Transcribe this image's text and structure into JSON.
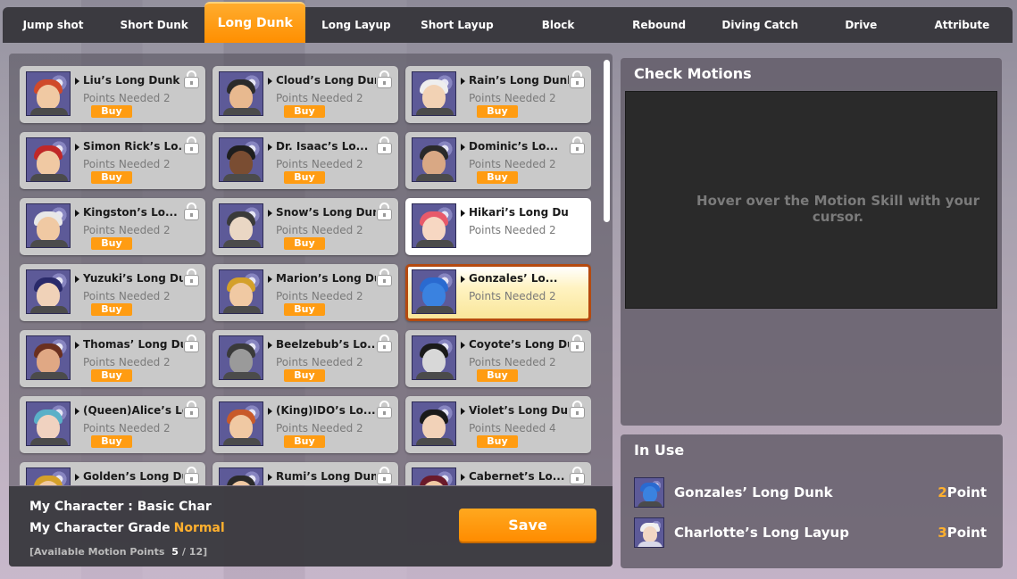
{
  "tabs": [
    {
      "label": "Jump shot",
      "active": false
    },
    {
      "label": "Short Dunk",
      "active": false
    },
    {
      "label": "Long Dunk",
      "active": true
    },
    {
      "label": "Long Layup",
      "active": false
    },
    {
      "label": "Short Layup",
      "active": false
    },
    {
      "label": "Block",
      "active": false
    },
    {
      "label": "Rebound",
      "active": false
    },
    {
      "label": "Diving Catch",
      "active": false
    },
    {
      "label": "Drive",
      "active": false
    },
    {
      "label": "Attribute",
      "active": false
    }
  ],
  "skills": [
    {
      "name": "Liu’s Long Dunk",
      "points": "Points Needed 2",
      "buy": "Buy",
      "state": "locked",
      "hair": "#d04a2a",
      "skin": "#f0c9a3"
    },
    {
      "name": "Cloud’s Long Dunk",
      "points": "Points Needed 2",
      "buy": "Buy",
      "state": "locked",
      "hair": "#2b2b2b",
      "skin": "#e8b98f"
    },
    {
      "name": "Rain’s Long Dunk",
      "points": "Points Needed 2",
      "buy": "Buy",
      "state": "locked",
      "hair": "#eeeeee",
      "skin": "#f2d2b4"
    },
    {
      "name": "Simon Rick’s Lo...",
      "points": "Points Needed 2",
      "buy": "Buy",
      "state": "locked",
      "hair": "#c02828",
      "skin": "#f0c9a3"
    },
    {
      "name": "Dr. Isaac’s Lo...",
      "points": "Points Needed 2",
      "buy": "Buy",
      "state": "locked",
      "hair": "#1e1e1e",
      "skin": "#7a4d32"
    },
    {
      "name": "Dominic’s Lo...",
      "points": "Points Needed 2",
      "buy": "Buy",
      "state": "locked",
      "hair": "#2a2a2a",
      "skin": "#d9a884"
    },
    {
      "name": "Kingston’s Lo...",
      "points": "Points Needed 2",
      "buy": "Buy",
      "state": "locked",
      "hair": "#e8e8e8",
      "skin": "#f0c9a3"
    },
    {
      "name": "Snow’s Long Dunk",
      "points": "Points Needed 2",
      "buy": "Buy",
      "state": "locked",
      "hair": "#3a3a3a",
      "skin": "#ead7c4"
    },
    {
      "name": "Hikari’s Long Dunk",
      "points": "Points Needed 2",
      "buy": "",
      "state": "owned",
      "hair": "#e85a6a",
      "skin": "#f7d7c2"
    },
    {
      "name": "Yuzuki’s Long Dunk",
      "points": "Points Needed 2",
      "buy": "Buy",
      "state": "locked",
      "hair": "#2a2a6a",
      "skin": "#f0d2b8"
    },
    {
      "name": "Marion’s Long Dunk",
      "points": "Points Needed 2",
      "buy": "Buy",
      "state": "locked",
      "hair": "#d4a02a",
      "skin": "#f0c9a3"
    },
    {
      "name": "Gonzales’ Lo...",
      "points": "Points Needed 2",
      "buy": "",
      "state": "selected",
      "hair": "#2a6ad0",
      "skin": "#3a82e0"
    },
    {
      "name": "Thomas’ Long Dunk",
      "points": "Points Needed 2",
      "buy": "Buy",
      "state": "locked",
      "hair": "#6a3020",
      "skin": "#e0a884"
    },
    {
      "name": "Beelzebub’s Lo...",
      "points": "Points Needed 2",
      "buy": "Buy",
      "state": "locked",
      "hair": "#3a3a3a",
      "skin": "#9a9a9a"
    },
    {
      "name": "Coyote’s Long Dunk",
      "points": "Points Needed 2",
      "buy": "Buy",
      "state": "locked",
      "hair": "#1a1a1a",
      "skin": "#d8d8d8"
    },
    {
      "name": "(Queen)Alice’s Lo...",
      "points": "Points Needed 2",
      "buy": "Buy",
      "state": "locked",
      "hair": "#5ab0c8",
      "skin": "#f0d2c0"
    },
    {
      "name": "(King)IDO’s Lo...",
      "points": "Points Needed 2",
      "buy": "Buy",
      "state": "locked",
      "hair": "#c85a2a",
      "skin": "#f0c9a3"
    },
    {
      "name": "Violet’s Long Dunk",
      "points": "Points Needed 4",
      "buy": "Buy",
      "state": "locked",
      "hair": "#1a1a1a",
      "skin": "#f2d2b8"
    },
    {
      "name": "Golden’s Long Dunk",
      "points": "",
      "buy": "",
      "state": "locked",
      "hair": "#d4a02a",
      "skin": "#f0c9a3"
    },
    {
      "name": "Rumi’s Long Dunk",
      "points": "",
      "buy": "",
      "state": "locked",
      "hair": "#2a2a2a",
      "skin": "#f0c9a3"
    },
    {
      "name": "Cabernet’s Lo...",
      "points": "",
      "buy": "",
      "state": "locked",
      "hair": "#6a1a2a",
      "skin": "#f0c9a3"
    }
  ],
  "footer": {
    "my_character_label": "My Character : Basic Char",
    "grade_label": "My Character Grade",
    "grade_value": "Normal",
    "points_label": "[Available Motion Points",
    "points_current": "5",
    "points_sep": "/",
    "points_total": "12]",
    "save_label": "Save"
  },
  "check_motions": {
    "title": "Check Motions",
    "hint": "Hover over the Motion Skill with your cursor."
  },
  "in_use": {
    "title": "In Use",
    "items": [
      {
        "name": "Gonzales’ Long Dunk",
        "points": "2",
        "unit": "Point",
        "hair": "#2a6ad0",
        "skin": "#3a82e0"
      },
      {
        "name": "Charlotte’s Long Layup",
        "points": "3",
        "unit": "Point",
        "hair": "#f0f0f0",
        "skin": "#f2d7c4"
      }
    ]
  },
  "colors": {
    "accent": "#ff9c12",
    "selected_border": "#b54a0f",
    "grade": "#ffb02e"
  }
}
